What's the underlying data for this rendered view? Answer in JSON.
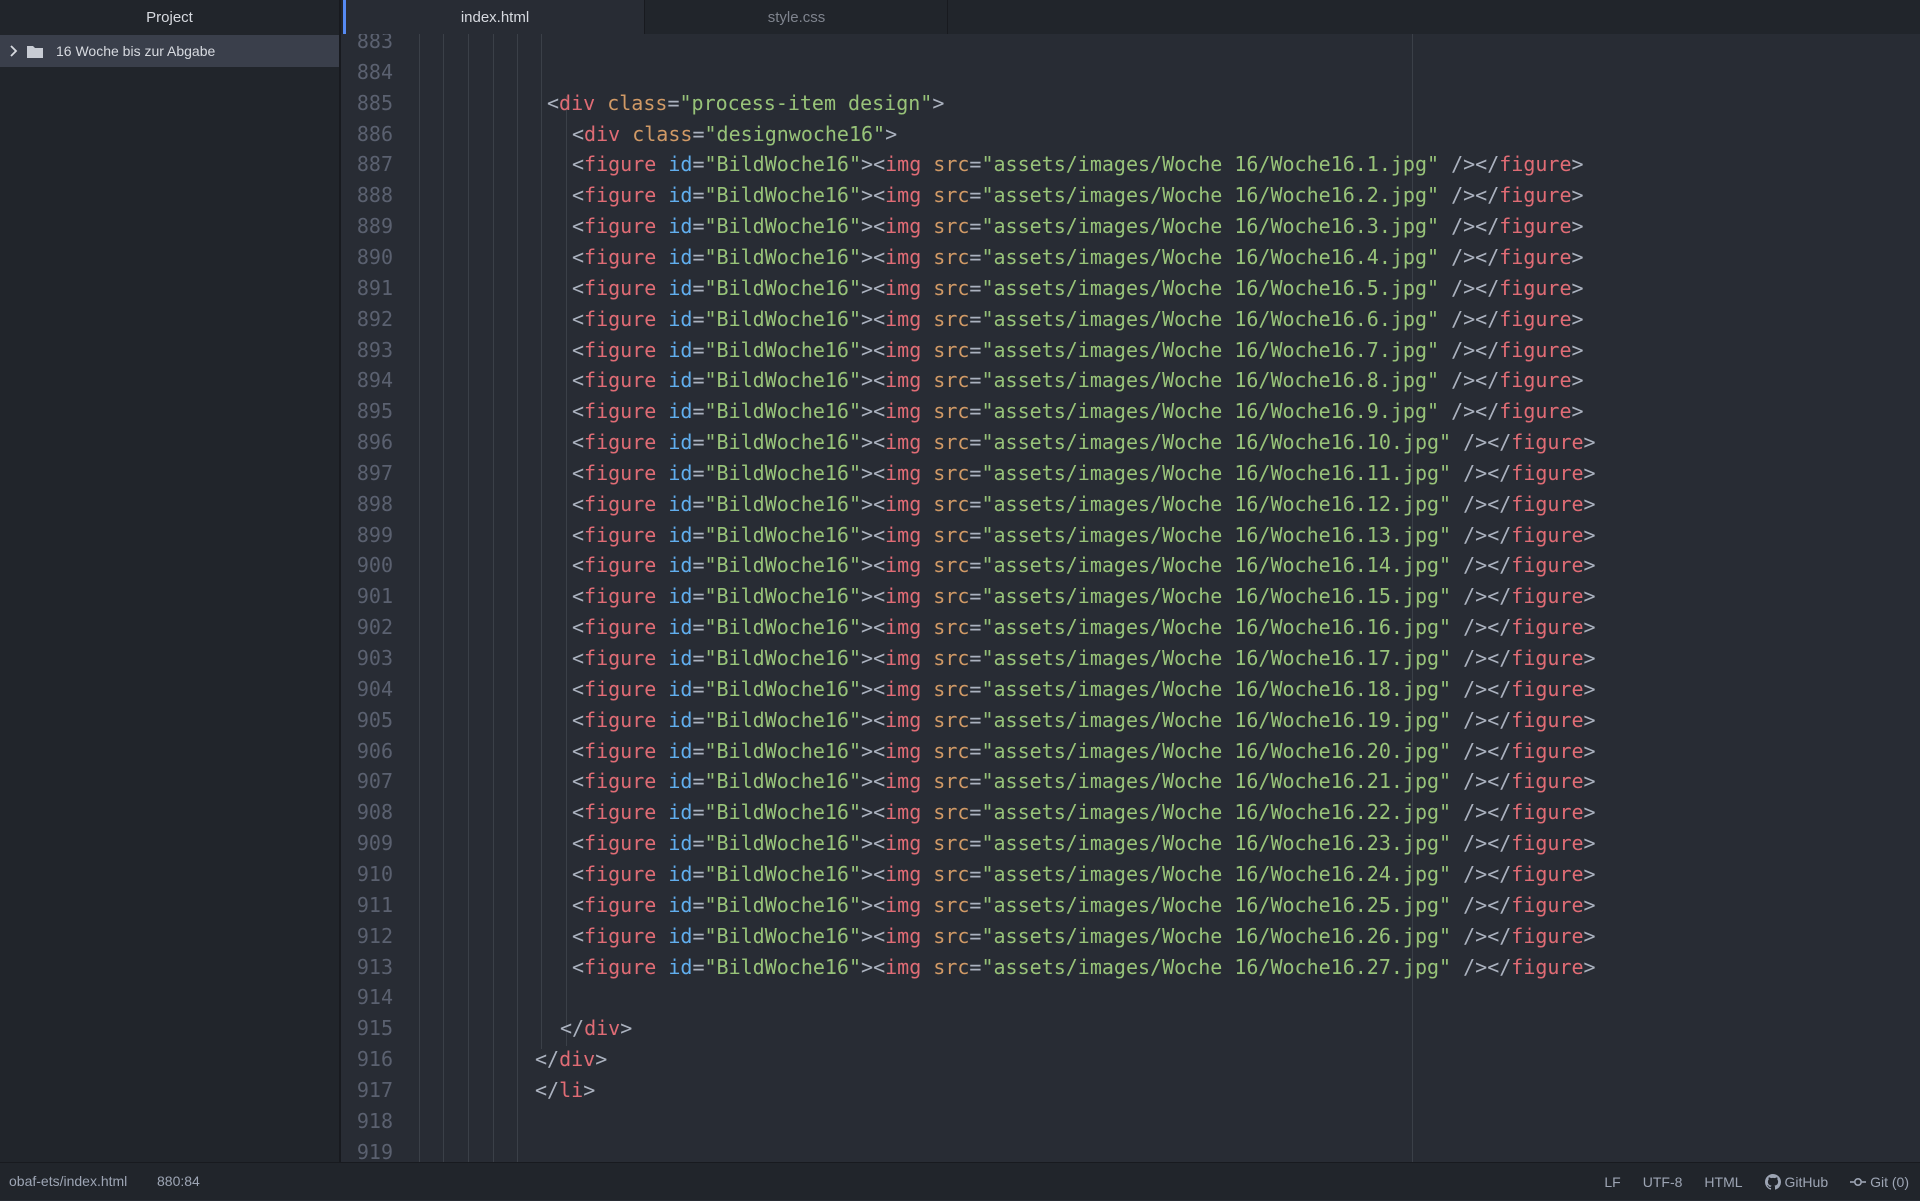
{
  "panel": {
    "title": "Project"
  },
  "tabs": [
    {
      "label": "index.html",
      "active": true
    },
    {
      "label": "style.css",
      "active": false
    }
  ],
  "sidebar": {
    "items": [
      {
        "label": "16 Woche bis zur Abgabe",
        "icon": "folder-icon"
      }
    ]
  },
  "editor": {
    "lines": [
      {
        "n": "883",
        "code": ""
      },
      {
        "n": "884",
        "code": ""
      },
      {
        "n": "885",
        "code": "<div class=\"process-item design\">"
      },
      {
        "n": "886",
        "code": "<div class=\"designwoche16\">"
      },
      {
        "n": "887",
        "code": "<figure id=\"BildWoche16\"><img src=\"assets/images/Woche 16/Woche16.1.jpg\" /></figure>"
      },
      {
        "n": "888",
        "code": "<figure id=\"BildWoche16\"><img src=\"assets/images/Woche 16/Woche16.2.jpg\" /></figure>"
      },
      {
        "n": "889",
        "code": "<figure id=\"BildWoche16\"><img src=\"assets/images/Woche 16/Woche16.3.jpg\" /></figure>"
      },
      {
        "n": "890",
        "code": "<figure id=\"BildWoche16\"><img src=\"assets/images/Woche 16/Woche16.4.jpg\" /></figure>"
      },
      {
        "n": "891",
        "code": "<figure id=\"BildWoche16\"><img src=\"assets/images/Woche 16/Woche16.5.jpg\" /></figure>"
      },
      {
        "n": "892",
        "code": "<figure id=\"BildWoche16\"><img src=\"assets/images/Woche 16/Woche16.6.jpg\" /></figure>"
      },
      {
        "n": "893",
        "code": "<figure id=\"BildWoche16\"><img src=\"assets/images/Woche 16/Woche16.7.jpg\" /></figure>"
      },
      {
        "n": "894",
        "code": "<figure id=\"BildWoche16\"><img src=\"assets/images/Woche 16/Woche16.8.jpg\" /></figure>"
      },
      {
        "n": "895",
        "code": "<figure id=\"BildWoche16\"><img src=\"assets/images/Woche 16/Woche16.9.jpg\" /></figure>"
      },
      {
        "n": "896",
        "code": "<figure id=\"BildWoche16\"><img src=\"assets/images/Woche 16/Woche16.10.jpg\" /></figure>"
      },
      {
        "n": "897",
        "code": "<figure id=\"BildWoche16\"><img src=\"assets/images/Woche 16/Woche16.11.jpg\" /></figure>"
      },
      {
        "n": "898",
        "code": "<figure id=\"BildWoche16\"><img src=\"assets/images/Woche 16/Woche16.12.jpg\" /></figure>"
      },
      {
        "n": "899",
        "code": "<figure id=\"BildWoche16\"><img src=\"assets/images/Woche 16/Woche16.13.jpg\" /></figure>"
      },
      {
        "n": "900",
        "code": "<figure id=\"BildWoche16\"><img src=\"assets/images/Woche 16/Woche16.14.jpg\" /></figure>"
      },
      {
        "n": "901",
        "code": "<figure id=\"BildWoche16\"><img src=\"assets/images/Woche 16/Woche16.15.jpg\" /></figure>"
      },
      {
        "n": "902",
        "code": "<figure id=\"BildWoche16\"><img src=\"assets/images/Woche 16/Woche16.16.jpg\" /></figure>"
      },
      {
        "n": "903",
        "code": "<figure id=\"BildWoche16\"><img src=\"assets/images/Woche 16/Woche16.17.jpg\" /></figure>"
      },
      {
        "n": "904",
        "code": "<figure id=\"BildWoche16\"><img src=\"assets/images/Woche 16/Woche16.18.jpg\" /></figure>"
      },
      {
        "n": "905",
        "code": "<figure id=\"BildWoche16\"><img src=\"assets/images/Woche 16/Woche16.19.jpg\" /></figure>"
      },
      {
        "n": "906",
        "code": "<figure id=\"BildWoche16\"><img src=\"assets/images/Woche 16/Woche16.20.jpg\" /></figure>"
      },
      {
        "n": "907",
        "code": "<figure id=\"BildWoche16\"><img src=\"assets/images/Woche 16/Woche16.21.jpg\" /></figure>"
      },
      {
        "n": "908",
        "code": "<figure id=\"BildWoche16\"><img src=\"assets/images/Woche 16/Woche16.22.jpg\" /></figure>"
      },
      {
        "n": "909",
        "code": "<figure id=\"BildWoche16\"><img src=\"assets/images/Woche 16/Woche16.23.jpg\" /></figure>"
      },
      {
        "n": "910",
        "code": "<figure id=\"BildWoche16\"><img src=\"assets/images/Woche 16/Woche16.24.jpg\" /></figure>"
      },
      {
        "n": "911",
        "code": "<figure id=\"BildWoche16\"><img src=\"assets/images/Woche 16/Woche16.25.jpg\" /></figure>"
      },
      {
        "n": "912",
        "code": "<figure id=\"BildWoche16\"><img src=\"assets/images/Woche 16/Woche16.26.jpg\" /></figure>"
      },
      {
        "n": "913",
        "code": "<figure id=\"BildWoche16\"><img src=\"assets/images/Woche 16/Woche16.27.jpg\" /></figure>"
      },
      {
        "n": "914",
        "code": ""
      },
      {
        "n": "915",
        "code": "</div>"
      },
      {
        "n": "916",
        "code": "</div>"
      },
      {
        "n": "917",
        "code": "</li>"
      },
      {
        "n": "918",
        "code": ""
      },
      {
        "n": "919",
        "code": ""
      }
    ]
  },
  "status": {
    "file_path": "obaf-ets/index.html",
    "cursor": "880:84",
    "line_ending": "LF",
    "encoding": "UTF-8",
    "grammar": "HTML",
    "github": "GitHub",
    "git": "Git (0)"
  },
  "colors": {
    "accent": "#568af2",
    "tag": "#e06c75",
    "attribute": "#d19a66",
    "attribute_id": "#61afef",
    "string": "#98c379",
    "background": "#282c34",
    "panel": "#21252b"
  }
}
